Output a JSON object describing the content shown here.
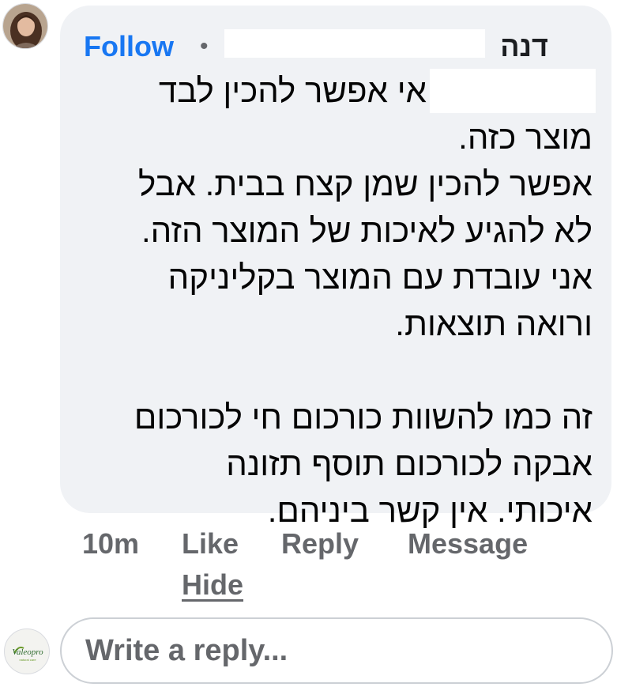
{
  "comment": {
    "follow_label": "Follow",
    "separator": "•",
    "author_name": "דנה",
    "body_lines": [
      "אי אפשר להכין לבד",
      "מוצר כזה.",
      "אפשר להכין שמן קצח בבית.  אבל",
      "לא להגיע לאיכות של המוצר הזה.",
      "אני עובדת עם המוצר בקליניקה",
      "ורואה תוצאות.",
      "",
      "זה כמו להשוות כורכום חי לכורכום",
      "אבקה לכורכום תוסף תזונה",
      "איכותי. אין קשר ביניהם."
    ]
  },
  "actions": {
    "time": "10m",
    "like_label": "Like",
    "reply_label": "Reply",
    "message_label": "Message",
    "hide_label": "Hide"
  },
  "reply": {
    "placeholder": "Write a reply...",
    "page_avatar_text": "Valeopro"
  },
  "colors": {
    "bubble_bg": "#f0f2f5",
    "link_blue": "#1877f2",
    "muted_gray": "#65676b",
    "brand_green": "#6a9a2a"
  }
}
